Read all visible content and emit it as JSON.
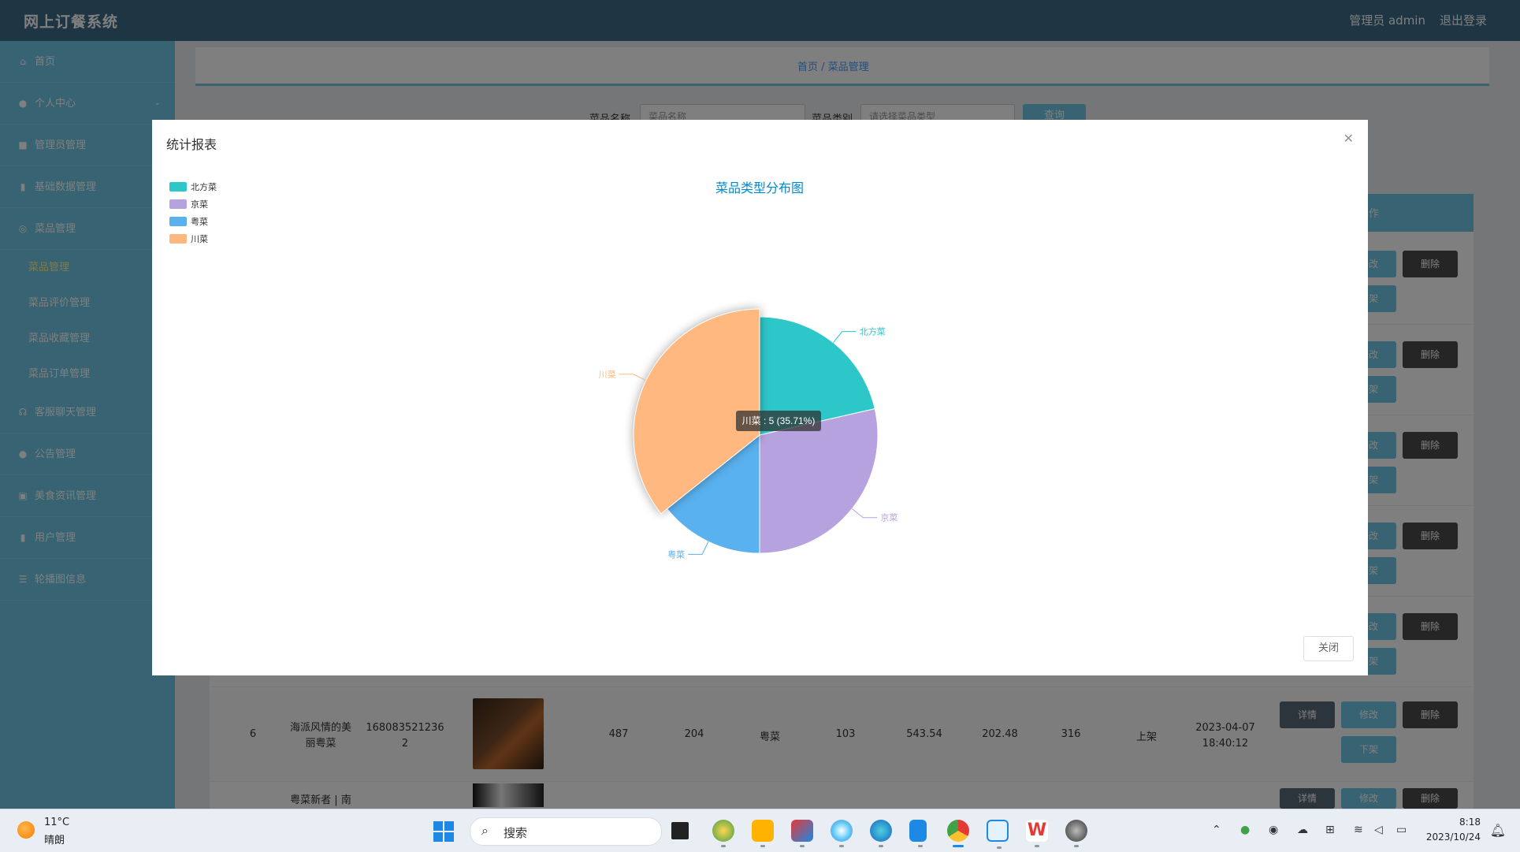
{
  "app": {
    "title": "网上订餐系统",
    "admin_label": "管理员 admin",
    "logout_label": "退出登录"
  },
  "sidebar": {
    "items": [
      {
        "label": "首页",
        "icon": "home-icon"
      },
      {
        "label": "个人中心",
        "icon": "user-icon"
      },
      {
        "label": "管理员管理",
        "icon": "user-group-icon"
      },
      {
        "label": "基础数据管理",
        "icon": "database-icon"
      },
      {
        "label": "菜品管理",
        "icon": "dish-icon"
      }
    ],
    "subitems": [
      {
        "label": "菜品管理",
        "active": true
      },
      {
        "label": "菜品评价管理"
      },
      {
        "label": "菜品收藏管理"
      },
      {
        "label": "菜品订单管理"
      }
    ],
    "items2": [
      {
        "label": "客服聊天管理",
        "icon": "chat-icon"
      },
      {
        "label": "公告管理",
        "icon": "announce-icon"
      },
      {
        "label": "美食资讯管理",
        "icon": "news-icon"
      },
      {
        "label": "用户管理",
        "icon": "users-icon"
      },
      {
        "label": "轮播图信息",
        "icon": "carousel-icon"
      }
    ]
  },
  "breadcrumb": "首页 / 菜品管理",
  "search": {
    "name_label": "菜品名称",
    "name_placeholder": "菜品名称",
    "type_label": "菜品类别",
    "type_placeholder": "请选择菜品类型",
    "query_label": "查询"
  },
  "table": {
    "ops_header": "操作",
    "row": {
      "index": "6",
      "name": "海派风情的美丽粤菜",
      "code": "1680835212362",
      "v1": "487",
      "v2": "204",
      "category": "粤菜",
      "v3": "103",
      "price1": "543.54",
      "price2": "202.48",
      "v4": "316",
      "status": "上架",
      "date": "2023-04-07 18:40:12"
    },
    "row_next_name": "粤菜新者 | 南",
    "btn_detail": "详情",
    "btn_edit": "修改",
    "btn_delete": "删除",
    "btn_down": "下架"
  },
  "modal": {
    "title": "统计报表",
    "close_btn": "关闭"
  },
  "chart_data": {
    "type": "pie",
    "title": "菜品类型分布图",
    "categories": [
      "北方菜",
      "京菜",
      "粤菜",
      "川菜"
    ],
    "values": [
      3,
      4,
      2,
      5
    ],
    "colors": [
      "#2ec7c9",
      "#b6a2de",
      "#5ab1ef",
      "#ffb980"
    ],
    "legend": "top-left",
    "tooltip": "川菜 : 5 (35.71%)",
    "highlighted": "川菜"
  },
  "taskbar": {
    "weather_temp": "11°C",
    "weather_desc": "晴朗",
    "search_placeholder": "搜索",
    "time": "8:18",
    "date": "2023/10/24"
  }
}
